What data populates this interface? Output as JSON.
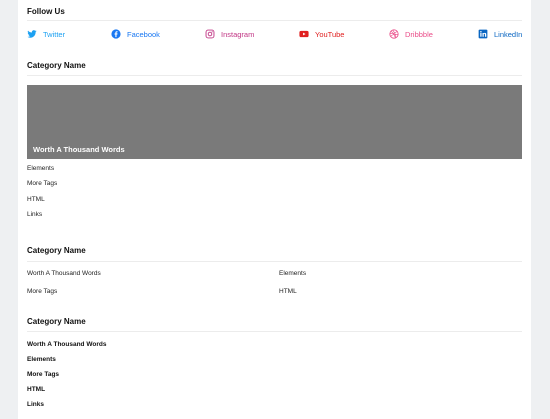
{
  "follow_us": {
    "title": "Follow Us",
    "links": [
      {
        "label": "Twitter",
        "icon": "twitter-icon",
        "color": "#1da1f2"
      },
      {
        "label": "Facebook",
        "icon": "facebook-icon",
        "color": "#1877f2"
      },
      {
        "label": "Instagram",
        "icon": "instagram-icon",
        "color": "#c13584"
      },
      {
        "label": "YouTube",
        "icon": "youtube-icon",
        "color": "#e02020"
      },
      {
        "label": "Dribbble",
        "icon": "dribbble-icon",
        "color": "#ea4c89"
      },
      {
        "label": "LinkedIn",
        "icon": "linkedin-icon",
        "color": "#0a66c2"
      }
    ]
  },
  "section1": {
    "title": "Category Name",
    "feature_caption": "Worth A Thousand Words",
    "links": [
      "Elements",
      "More Tags",
      "HTML",
      "Links"
    ]
  },
  "section2": {
    "title": "Category Name",
    "links": [
      "Worth A Thousand Words",
      "Elements",
      "More Tags",
      "HTML"
    ]
  },
  "section3": {
    "title": "Category Name",
    "links": [
      "Worth A Thousand Words",
      "Elements",
      "More Tags",
      "HTML",
      "Links"
    ]
  }
}
